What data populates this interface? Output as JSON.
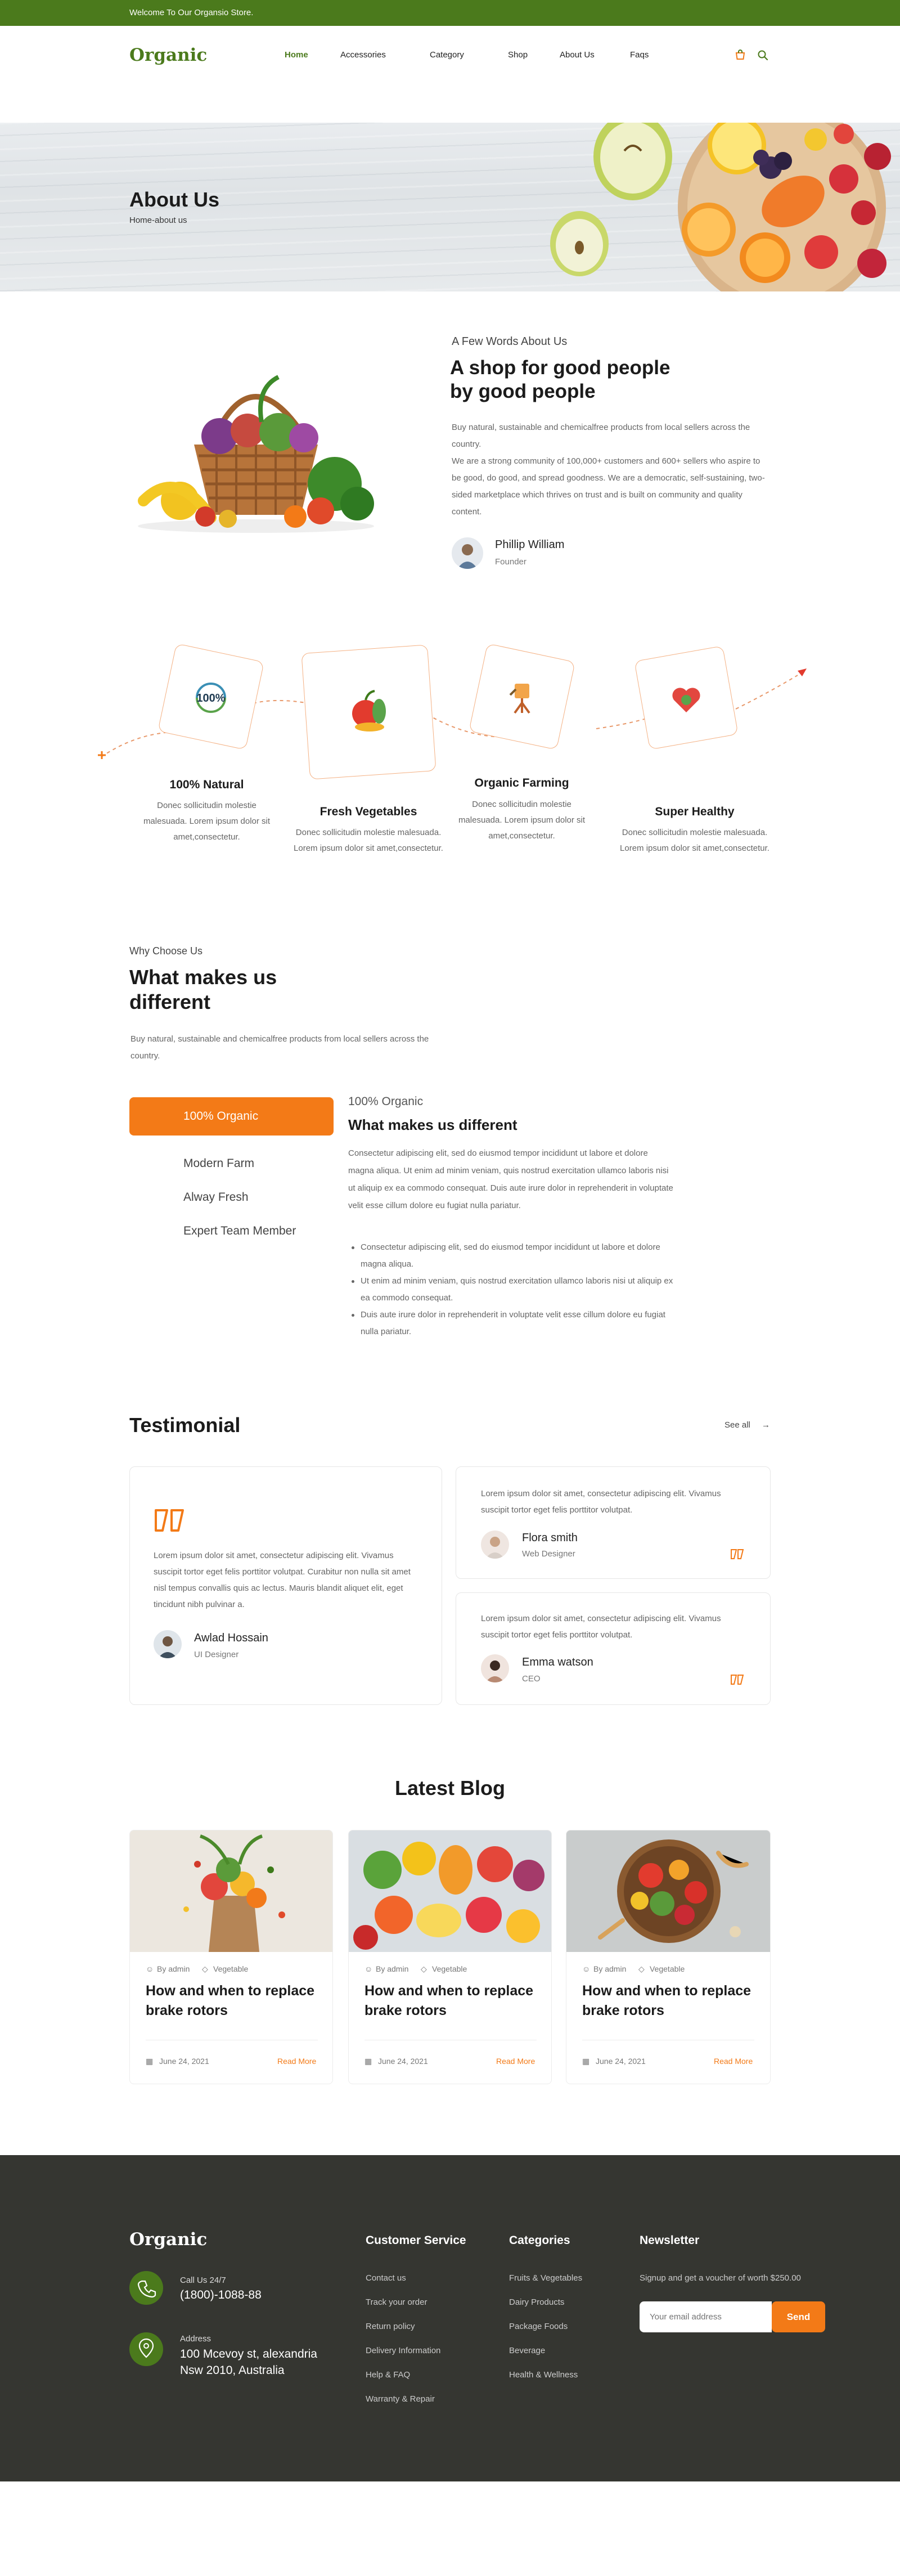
{
  "topbar": {
    "welcome": "Welcome To Our Organsio Store."
  },
  "header": {
    "logo": "Organic",
    "nav": [
      "Home",
      "Accessories",
      "Category",
      "Shop",
      "About Us",
      "Faqs"
    ],
    "active_nav": "Home"
  },
  "hero": {
    "title": "About Us",
    "breadcrumb": "Home-about us"
  },
  "about": {
    "kicker": "A Few Words About Us",
    "title": "A shop for good people by good people",
    "paragraph_1": "Buy natural, sustainable and chemicalfree products from local sellers across the country.",
    "paragraph_2": "We are a strong community of 100,000+ customers and 600+ sellers who aspire to be good, do good, and spread goodness. We are a democratic, self-sustaining, two-sided marketplace which thrives on trust and is built on community and quality content.",
    "person": {
      "name": "Phillip William",
      "role": "Founder"
    }
  },
  "features": [
    {
      "title": "100% Natural",
      "desc": "Donec sollicitudin molestie malesuada. Lorem ipsum dolor sit amet,consectetur.",
      "icon": "hundred-percent-icon"
    },
    {
      "title": "Fresh Vegetables",
      "desc": "Donec sollicitudin molestie malesuada. Lorem ipsum dolor sit amet,consectetur.",
      "icon": "fruit-icon"
    },
    {
      "title": "Organic Farming",
      "desc": "Donec sollicitudin molestie malesuada. Lorem ipsum dolor sit amet,consectetur.",
      "icon": "farming-icon"
    },
    {
      "title": "Super Healthy",
      "desc": "Donec sollicitudin molestie malesuada. Lorem ipsum dolor sit amet,consectetur.",
      "icon": "healthy-heart-icon"
    }
  ],
  "why": {
    "kicker": "Why Choose Us",
    "title": "What makes us different",
    "paragraph": "Buy natural, sustainable and chemicalfree products from local sellers across the country.",
    "tabs": [
      "100% Organic",
      "Modern Farm",
      "Alway Fresh",
      "Expert Team Member"
    ],
    "active_tab": "100% Organic",
    "detail": {
      "kicker": "100% Organic",
      "title": "What makes us different",
      "paragraph": "Consectetur adipiscing elit, sed do eiusmod tempor incididunt ut labore et dolore magna aliqua. Ut enim ad minim veniam, quis nostrud exercitation ullamco laboris nisi ut aliquip ex ea commodo consequat. Duis aute irure dolor in reprehenderit in voluptate velit esse cillum dolore eu fugiat nulla pariatur.",
      "bullets": [
        "Consectetur adipiscing elit, sed do eiusmod tempor incididunt ut labore et dolore magna aliqua.",
        "Ut enim ad minim veniam, quis nostrud exercitation ullamco laboris nisi ut aliquip ex ea commodo consequat.",
        "Duis aute irure dolor in reprehenderit in voluptate velit esse cillum dolore eu fugiat nulla pariatur."
      ]
    }
  },
  "testimonial": {
    "title": "Testimonial",
    "see_all": "See all",
    "featured": {
      "text": "Lorem ipsum dolor sit amet, consectetur adipiscing elit. Vivamus suscipit tortor eget felis porttitor volutpat. Curabitur non nulla sit amet nisl tempus convallis quis ac lectus. Mauris blandit aliquet elit, eget tincidunt nibh pulvinar a.",
      "name": "Awlad Hossain",
      "role": "UI Designer"
    },
    "items": [
      {
        "text": "Lorem ipsum dolor sit amet, consectetur adipiscing elit. Vivamus suscipit tortor eget felis porttitor volutpat.",
        "name": "Flora smith",
        "role": "Web Designer"
      },
      {
        "text": "Lorem ipsum dolor sit amet, consectetur adipiscing elit. Vivamus suscipit tortor eget felis porttitor volutpat.",
        "name": "Emma watson",
        "role": "CEO"
      }
    ]
  },
  "blog": {
    "heading": "Latest Blog",
    "posts": [
      {
        "author": "By admin",
        "tag": "Vegetable",
        "title": "How and when to replace brake rotors",
        "date": "June 24, 2021",
        "more": "Read More"
      },
      {
        "author": "By admin",
        "tag": "Vegetable",
        "title": "How and when to replace brake rotors",
        "date": "June 24, 2021",
        "more": "Read More"
      },
      {
        "author": "By admin",
        "tag": "Vegetable",
        "title": "How and when to replace brake rotors",
        "date": "June 24, 2021",
        "more": "Read More"
      }
    ]
  },
  "footer": {
    "logo": "Organic",
    "call_label": "Call Us 24/7",
    "call_number": "(1800)-1088-88",
    "address_label": "Address",
    "address_line1": "100 Mcevoy st, alexandria",
    "address_line2": "Nsw 2010, Australia",
    "customer_service": {
      "title": "Customer Service",
      "links": [
        "Contact us",
        "Track your order",
        "Return policy",
        "Delivery Information",
        "Help & FAQ",
        "Warranty & Repair"
      ]
    },
    "categories": {
      "title": "Categories",
      "links": [
        "Fruits & Vegetables",
        "Dairy Products",
        "Package Foods",
        "Beverage",
        "Health & Wellness"
      ]
    },
    "newsletter": {
      "title": "Newsletter",
      "text": "Signup and get a voucher of worth $250.00",
      "placeholder": "Your email address",
      "send": "Send"
    }
  },
  "colors": {
    "brand_green": "#4b7a1c",
    "accent_orange": "#f37a17",
    "footer_bg": "#353631"
  }
}
